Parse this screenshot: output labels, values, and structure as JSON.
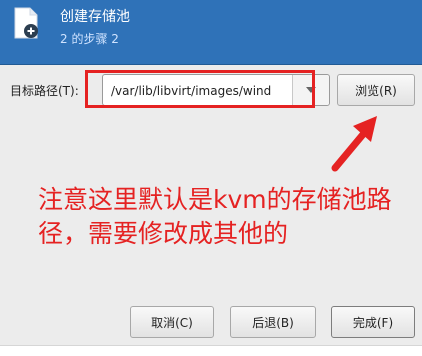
{
  "header": {
    "title": "创建存储池",
    "subtitle": "2 的步骤 2",
    "icon": "new-document-icon",
    "color": "#2f72b8"
  },
  "form": {
    "target_path_label": "目标路径(T):",
    "target_path_value": "/var/lib/libvirt/images/wind",
    "browse_label": "浏览(R)"
  },
  "annotation": {
    "text": "注意这里默认是kvm的存储池路径，需要修改成其他的",
    "color": "#e52222"
  },
  "footer": {
    "cancel_label": "取消(C)",
    "back_label": "后退(B)",
    "finish_label": "完成(F)"
  }
}
